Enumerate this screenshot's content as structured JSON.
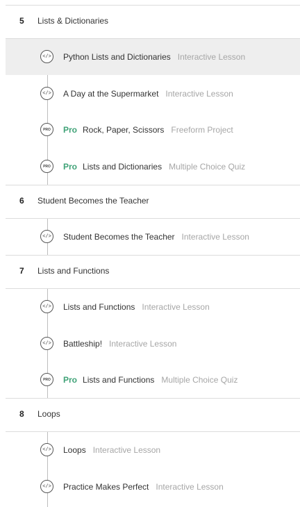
{
  "sections": [
    {
      "number": "5",
      "title": "Lists & Dictionaries",
      "lessons": [
        {
          "pro": false,
          "title": "Python Lists and Dictionaries",
          "type": "Interactive Lesson",
          "icon": "code-icon",
          "highlighted": true
        },
        {
          "pro": false,
          "title": "A Day at the Supermarket",
          "type": "Interactive Lesson",
          "icon": "code-icon"
        },
        {
          "pro": true,
          "pro_label": "Pro",
          "title": "Rock, Paper, Scissors",
          "type": "Freeform Project",
          "icon": "pro-icon"
        },
        {
          "pro": true,
          "pro_label": "Pro",
          "title": "Lists and Dictionaries",
          "type": "Multiple Choice Quiz",
          "icon": "pro-icon"
        }
      ]
    },
    {
      "number": "6",
      "title": "Student Becomes the Teacher",
      "lessons": [
        {
          "pro": false,
          "title": "Student Becomes the Teacher",
          "type": "Interactive Lesson",
          "icon": "code-icon"
        }
      ]
    },
    {
      "number": "7",
      "title": "Lists and Functions",
      "lessons": [
        {
          "pro": false,
          "title": "Lists and Functions",
          "type": "Interactive Lesson",
          "icon": "code-icon"
        },
        {
          "pro": false,
          "title": "Battleship!",
          "type": "Interactive Lesson",
          "icon": "code-icon"
        },
        {
          "pro": true,
          "pro_label": "Pro",
          "title": "Lists and Functions",
          "type": "Multiple Choice Quiz",
          "icon": "pro-icon"
        }
      ]
    },
    {
      "number": "8",
      "title": "Loops",
      "lessons": [
        {
          "pro": false,
          "title": "Loops",
          "type": "Interactive Lesson",
          "icon": "code-icon"
        },
        {
          "pro": false,
          "title": "Practice Makes Perfect",
          "type": "Interactive Lesson",
          "icon": "code-icon"
        }
      ]
    }
  ],
  "icon_glyphs": {
    "code-icon": "</>",
    "pro-icon": "PRO"
  },
  "colors": {
    "pro": "#3fa277",
    "muted": "#a6a6a6",
    "highlight": "#eeeeee"
  }
}
